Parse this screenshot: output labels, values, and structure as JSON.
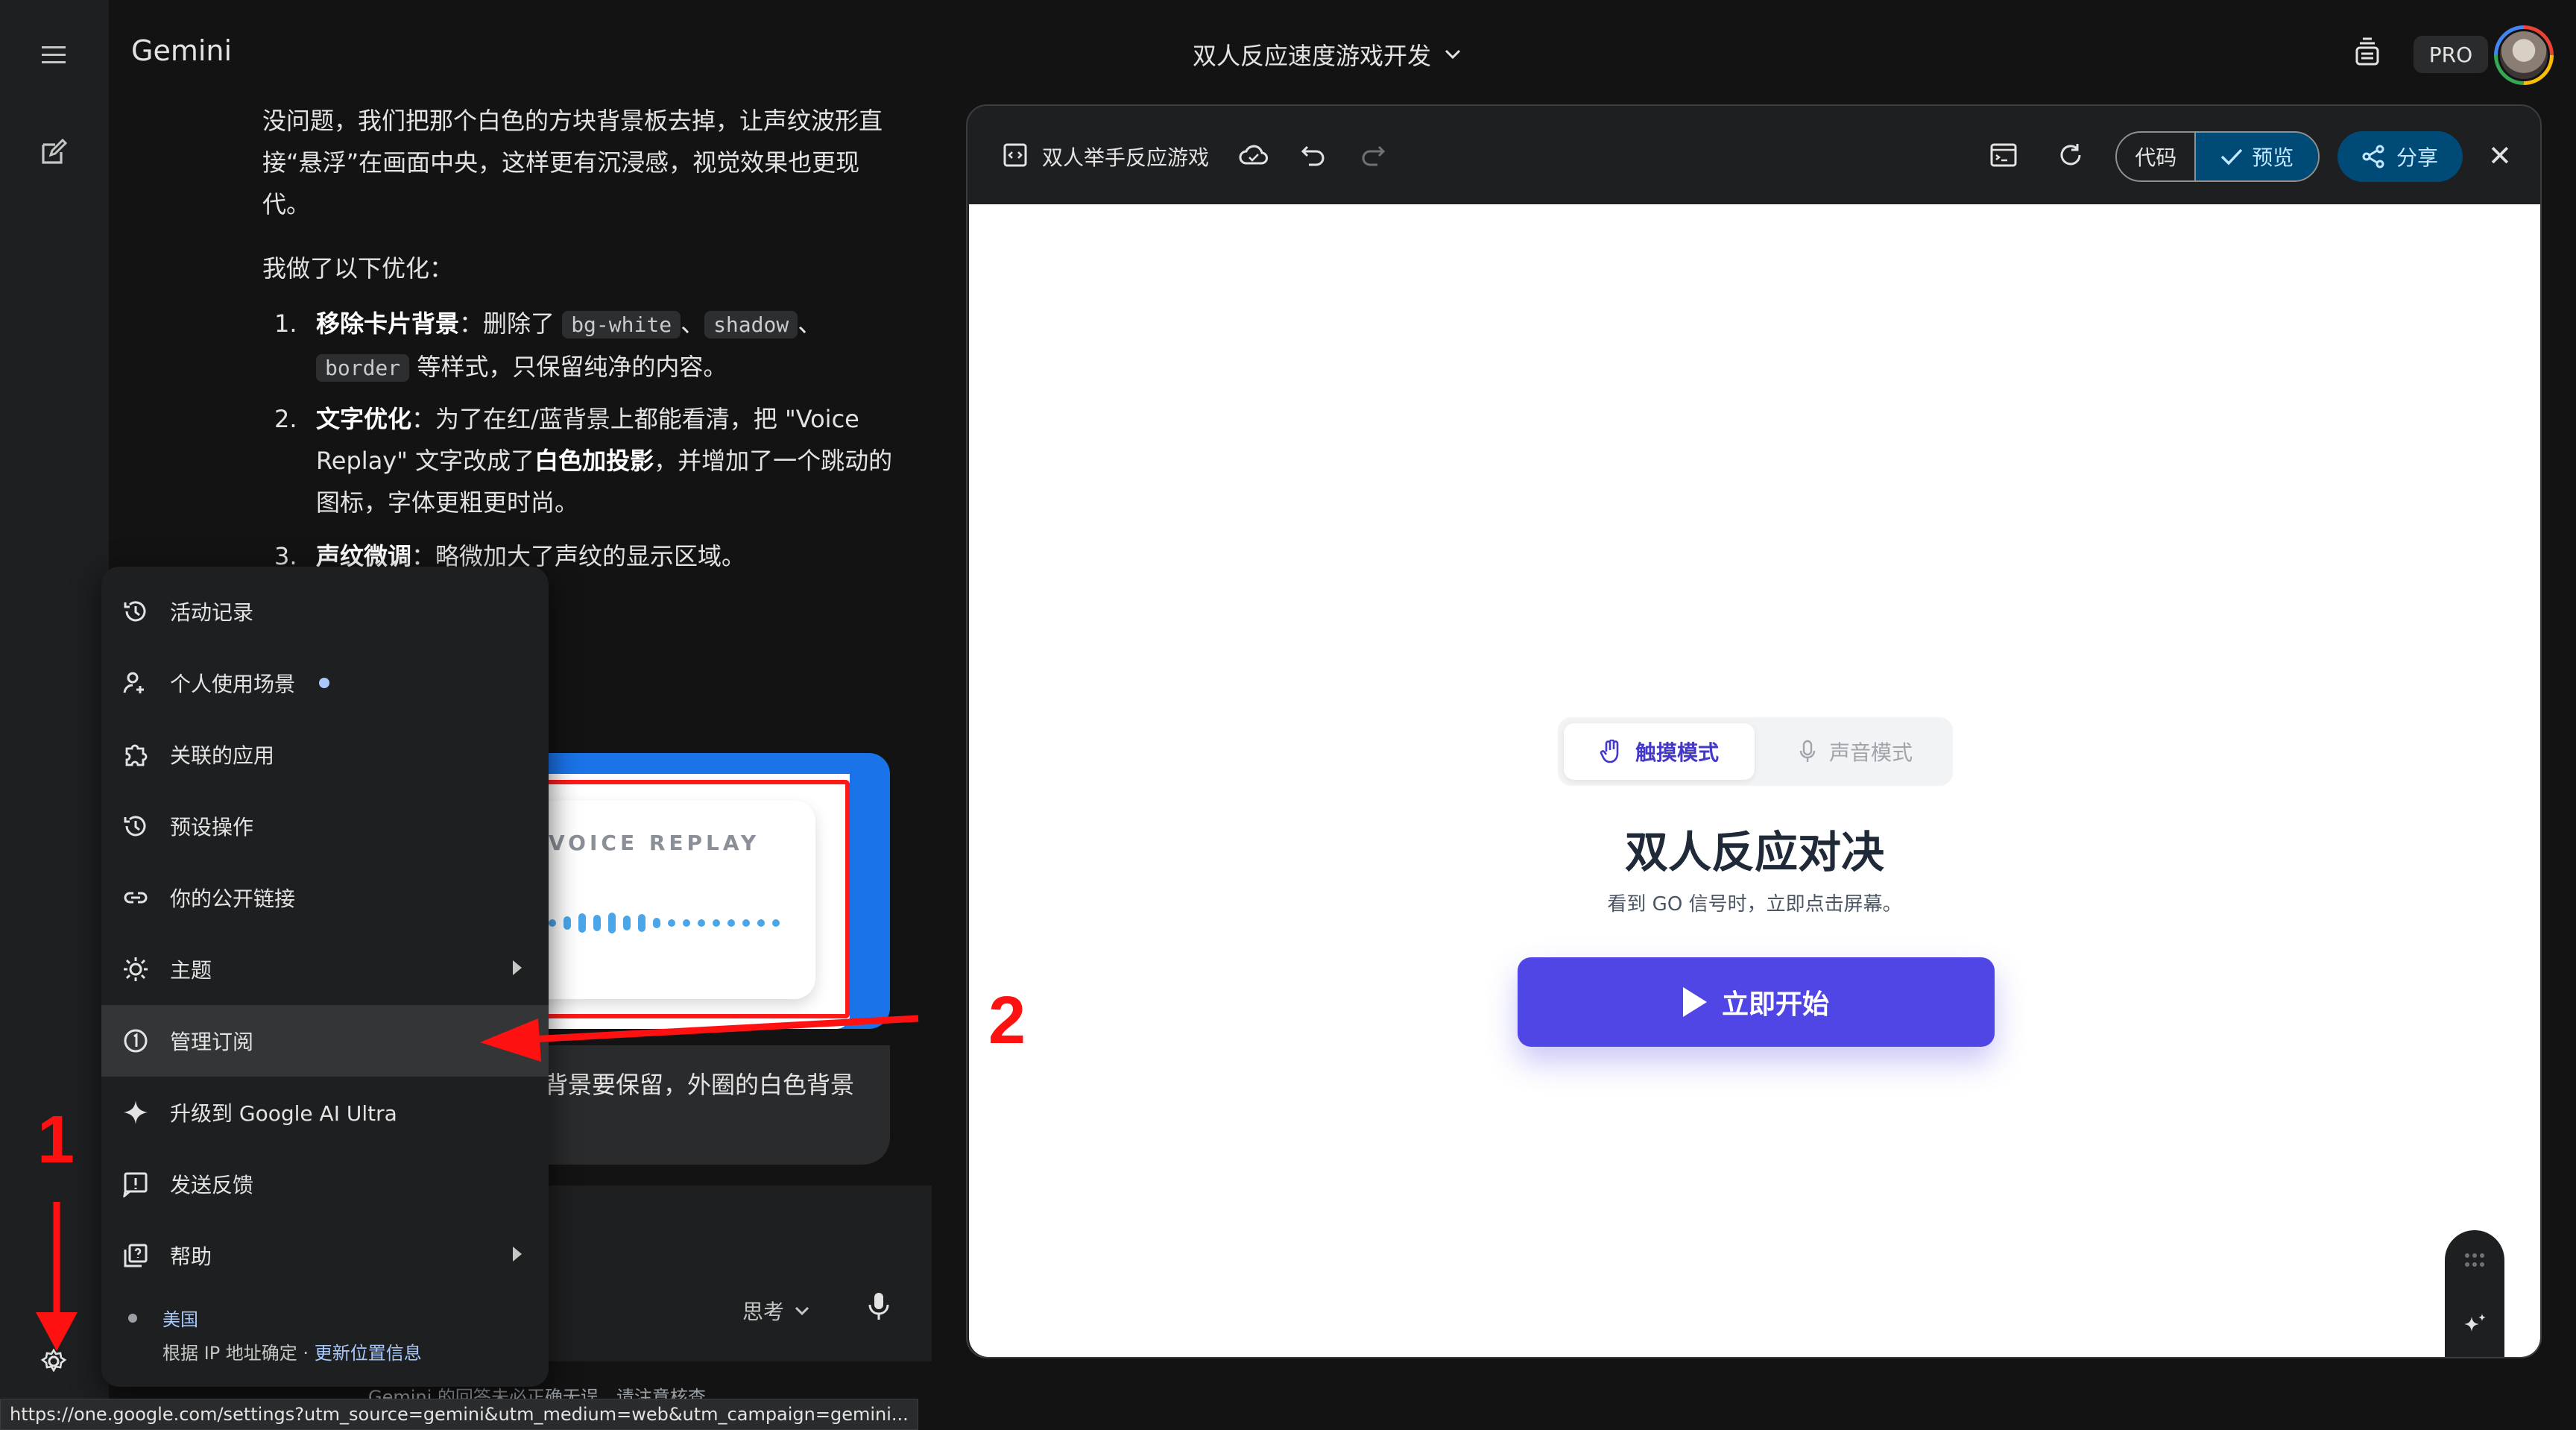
{
  "app": {
    "brand": "Gemini",
    "conversation_title": "双人反应速度游戏开发",
    "pro_badge": "PRO"
  },
  "chat": {
    "intro": "没问题，我们把那个白色的方块背景板去掉，让声纹波形直接“悬浮”在画面中央，这样更有沉浸感，视觉效果也更现代。",
    "lead": "我做了以下优化：",
    "list": [
      {
        "num": "1.",
        "title": "移除卡片背景",
        "t1": "：删除了 ",
        "code1": "bg-white",
        "sep1": "、",
        "code2": "shadow",
        "sep2": "、",
        "code3": "border",
        "t2": " 等样式，只保留纯净的内容。"
      },
      {
        "num": "2.",
        "title": "文字优化",
        "t1": "：为了在红/蓝背景上都能看清，把 \"Voice Replay\" 文字改成了",
        "bold": "白色加投影",
        "t2": "，并增加了一个跳动的图标，字体更粗更时尚。"
      },
      {
        "num": "3.",
        "title": "声纹微调",
        "t1": "：略微加大了声纹的显示区域。"
      }
    ],
    "card_text": "VOICE REPLAY",
    "bubble_text": "背景要保留，外圈的白色背景",
    "think_label": "思考",
    "disclaimer": "Gemini 的回答未必正确无误，请注意核查"
  },
  "menu": {
    "items": [
      {
        "id": "activity",
        "label": "活动记录",
        "icon": "history-icon"
      },
      {
        "id": "personal",
        "label": "个人使用场景",
        "icon": "person-context-icon",
        "dot": true
      },
      {
        "id": "apps",
        "label": "关联的应用",
        "icon": "puzzle-icon"
      },
      {
        "id": "actions",
        "label": "预设操作",
        "icon": "scheduled-icon"
      },
      {
        "id": "links",
        "label": "你的公开链接",
        "icon": "link-icon"
      },
      {
        "id": "theme",
        "label": "主题",
        "icon": "theme-icon",
        "submenu": true
      },
      {
        "id": "subscription",
        "label": "管理订阅",
        "icon": "subscription-icon",
        "active": true
      },
      {
        "id": "upgrade",
        "label": "升级到 Google AI Ultra",
        "icon": "sparkle-icon"
      },
      {
        "id": "feedback",
        "label": "发送反馈",
        "icon": "feedback-icon"
      },
      {
        "id": "help",
        "label": "帮助",
        "icon": "help-icon",
        "submenu": true
      }
    ],
    "location": {
      "country": "美国",
      "detail": "根据 IP 地址确定 · ",
      "update_link": "更新位置信息"
    }
  },
  "status_url": "https://one.google.com/settings?utm_source=gemini&utm_medium=web&utm_campaign=gemini...",
  "panel": {
    "title": "双人举手反应游戏",
    "seg_code": "代码",
    "seg_preview": "预览",
    "share": "分享",
    "close": "✕",
    "game": {
      "mode_touch": "触摸模式",
      "mode_voice": "声音模式",
      "title": "双人反应对决",
      "subtitle": "看到 GO 信号时，立即点击屏幕。",
      "start": "立即开始"
    }
  },
  "annotations": {
    "one": "1",
    "two": "2",
    "color": "#ff1111"
  }
}
